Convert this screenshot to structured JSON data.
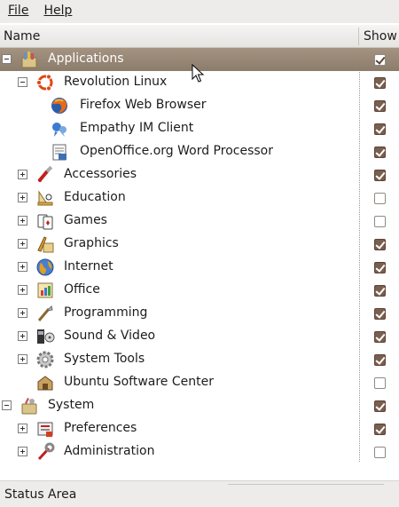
{
  "menu": {
    "file": "File",
    "help": "Help"
  },
  "columns": {
    "name": "Name",
    "show": "Show"
  },
  "rows": [
    {
      "label": "Applications",
      "level": 0,
      "expander": "minus",
      "icon": "applications-icon",
      "show": true,
      "selected": true
    },
    {
      "label": "Revolution Linux",
      "level": 1,
      "expander": "minus",
      "icon": "ubuntu-logo-icon",
      "show": true
    },
    {
      "label": "Firefox Web Browser",
      "level": 2,
      "expander": "none",
      "icon": "firefox-icon",
      "show": true
    },
    {
      "label": "Empathy IM Client",
      "level": 2,
      "expander": "none",
      "icon": "empathy-icon",
      "show": true
    },
    {
      "label": "OpenOffice.org Word Processor",
      "level": 2,
      "expander": "none",
      "icon": "writer-icon",
      "show": true
    },
    {
      "label": "Accessories",
      "level": 1,
      "expander": "plus",
      "icon": "accessories-icon",
      "show": true
    },
    {
      "label": "Education",
      "level": 1,
      "expander": "plus",
      "icon": "education-icon",
      "show": false
    },
    {
      "label": "Games",
      "level": 1,
      "expander": "plus",
      "icon": "games-icon",
      "show": false
    },
    {
      "label": "Graphics",
      "level": 1,
      "expander": "plus",
      "icon": "graphics-icon",
      "show": true
    },
    {
      "label": "Internet",
      "level": 1,
      "expander": "plus",
      "icon": "internet-globe-icon",
      "show": true
    },
    {
      "label": "Office",
      "level": 1,
      "expander": "plus",
      "icon": "office-icon",
      "show": true
    },
    {
      "label": "Programming",
      "level": 1,
      "expander": "plus",
      "icon": "programming-icon",
      "show": true
    },
    {
      "label": "Sound & Video",
      "level": 1,
      "expander": "plus",
      "icon": "sound-video-icon",
      "show": true
    },
    {
      "label": "System Tools",
      "level": 1,
      "expander": "plus",
      "icon": "system-tools-icon",
      "show": true
    },
    {
      "label": "Ubuntu Software Center",
      "level": 1,
      "expander": "none",
      "icon": "software-center-icon",
      "show": false
    },
    {
      "label": "System",
      "level": 0,
      "expander": "minus",
      "icon": "system-icon",
      "show": true
    },
    {
      "label": "Preferences",
      "level": 1,
      "expander": "plus",
      "icon": "preferences-icon",
      "show": true
    },
    {
      "label": "Administration",
      "level": 1,
      "expander": "plus",
      "icon": "administration-icon",
      "show": false
    }
  ],
  "status": {
    "text": "Status Area"
  },
  "colors": {
    "selection": "#9a8977",
    "checked": "#7a5e4e",
    "background": "#edeceb"
  }
}
